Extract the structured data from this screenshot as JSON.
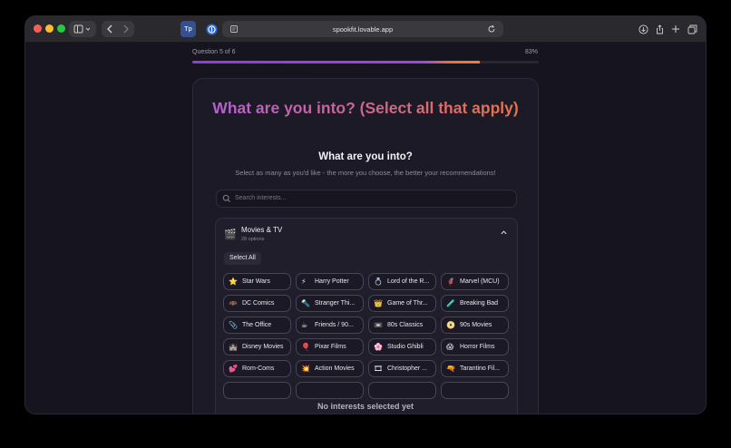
{
  "browser": {
    "url": "spookfit.lovable.app",
    "extension_badge": "Tp",
    "colors": {
      "close": "#ff5f57",
      "minimize": "#febc2e",
      "maximize": "#28c840"
    }
  },
  "quiz": {
    "question_label": "Question 5 of 6",
    "progress_label": "83%",
    "progress_fraction": 0.83,
    "title": "What are you into? (Select all that apply)",
    "subtitle": "What are you into?",
    "description": "Select as many as you'd like - the more you choose, the better your recommendations!",
    "search_placeholder": "Search interests...",
    "category": {
      "emoji": "🎬",
      "title": "Movies & TV",
      "count": "28 options",
      "select_all": "Select All",
      "options": [
        {
          "emoji": "⭐",
          "label": "Star Wars"
        },
        {
          "emoji": "⚡",
          "label": "Harry Potter"
        },
        {
          "emoji": "💍",
          "label": "Lord of the R..."
        },
        {
          "emoji": "🦸",
          "label": "Marvel (MCU)"
        },
        {
          "emoji": "🦇",
          "label": "DC Comics"
        },
        {
          "emoji": "🔦",
          "label": "Stranger Thi..."
        },
        {
          "emoji": "👑",
          "label": "Game of Thr..."
        },
        {
          "emoji": "🧪",
          "label": "Breaking Bad"
        },
        {
          "emoji": "📎",
          "label": "The Office"
        },
        {
          "emoji": "☕",
          "label": "Friends / 90..."
        },
        {
          "emoji": "📼",
          "label": "80s Classics"
        },
        {
          "emoji": "📀",
          "label": "90s Movies"
        },
        {
          "emoji": "🏰",
          "label": "Disney Movies"
        },
        {
          "emoji": "🎈",
          "label": "Pixar Films"
        },
        {
          "emoji": "🌸",
          "label": "Studio Ghibli"
        },
        {
          "emoji": "😱",
          "label": "Horror Films"
        },
        {
          "emoji": "💕",
          "label": "Rom-Coms"
        },
        {
          "emoji": "💥",
          "label": "Action Movies"
        },
        {
          "emoji": "🎞",
          "label": "Christopher ..."
        },
        {
          "emoji": "🔫",
          "label": "Tarantino Fil..."
        }
      ]
    },
    "footer_status": "No interests selected yet"
  }
}
